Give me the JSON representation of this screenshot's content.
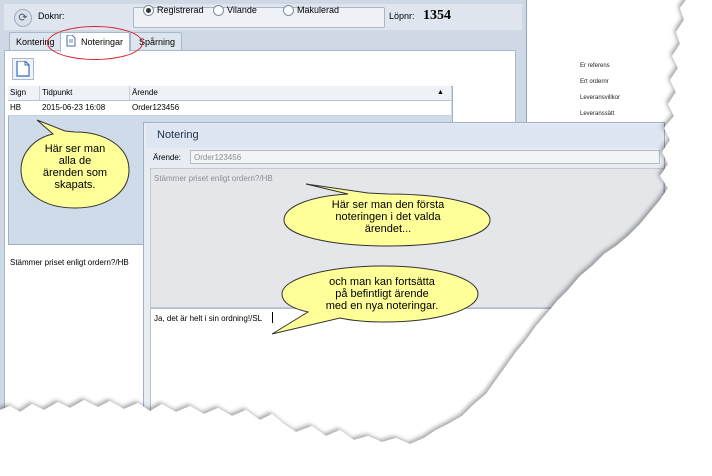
{
  "toolbar": {
    "doknr_label": "Doknr:",
    "radio_options": [
      "Registrerad",
      "Vilande",
      "Makulerad"
    ],
    "selected_radio": "Registrerad",
    "lopnr_label": "Löpnr:",
    "lopnr_value": "1354"
  },
  "tabs": [
    "Kontering",
    "Noteringar",
    "Spårning"
  ],
  "active_tab": "Noteringar",
  "grid": {
    "columns": [
      "Sign",
      "Tidpunkt",
      "Ärende"
    ],
    "rows": [
      {
        "sign": "HB",
        "tidpunkt": "2015-06-23 16:08",
        "arende": "Order123456"
      }
    ]
  },
  "note_preview": "Stämmer priset enligt ordern?/HB",
  "dialog": {
    "title": "Notering",
    "arende_label": "Ärende:",
    "arende_value": "Order123456",
    "previous_note": "Stämmer priset enligt ordern?/HB",
    "new_note": "Ja, det är helt i sin ordning!/SL"
  },
  "right_labels": [
    "Er referens",
    "Ert ordernr",
    "Leveransvillkor",
    "Leveranssätt"
  ],
  "callouts": {
    "c1": [
      "Här ser man",
      "alla de",
      "ärenden som",
      "skapats."
    ],
    "c2": [
      "Här ser man den första",
      "noteringen i det valda",
      "ärendet..."
    ],
    "c3": [
      "och man kan fortsätta",
      "på befintligt ärende",
      "med en nya noteringar."
    ]
  },
  "colors": {
    "callout_fill": "#ffff99",
    "highlight_oval": "#d8232a",
    "window_bg": "#cfd9e6"
  }
}
